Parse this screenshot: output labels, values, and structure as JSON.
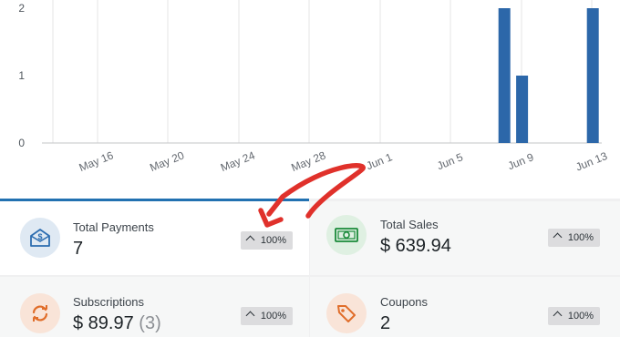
{
  "chart_data": {
    "type": "bar",
    "x_ticks": [
      "May 16",
      "May 20",
      "May 24",
      "May 28",
      "Jun 1",
      "Jun 5",
      "Jun 9",
      "Jun 13"
    ],
    "y_ticks": [
      "0",
      "1",
      "2"
    ],
    "ylim": [
      0,
      2
    ],
    "bars": [
      {
        "x": "Jun 8",
        "value": 2
      },
      {
        "x": "Jun 9",
        "value": 1
      },
      {
        "x": "Jun 13",
        "value": 2
      }
    ],
    "bar_color": "#2c67a9",
    "grid": "vertical"
  },
  "cards": [
    {
      "label": "Total Payments",
      "value": "7",
      "count": "",
      "change": "100%",
      "icon": "envelope-dollar-icon",
      "icon_color": "#2c6db0",
      "icon_bg": "#dfe9f3",
      "active": true
    },
    {
      "label": "Total Sales",
      "value": "$ 639.94",
      "count": "",
      "change": "100%",
      "icon": "cash-bill-icon",
      "icon_color": "#1a8a3a",
      "icon_bg": "#dff0e2",
      "active": false
    },
    {
      "label": "Subscriptions",
      "value": "$ 89.97",
      "count": "(3)",
      "change": "100%",
      "icon": "refresh-arrows-icon",
      "icon_color": "#e06d2a",
      "icon_bg": "#f9e4d8",
      "active": false
    },
    {
      "label": "Coupons",
      "value": "2",
      "count": "",
      "change": "100%",
      "icon": "tag-icon",
      "icon_color": "#e06d2a",
      "icon_bg": "#f9e4d8",
      "active": false
    }
  ],
  "annotation": {
    "color": "#e0312b"
  }
}
